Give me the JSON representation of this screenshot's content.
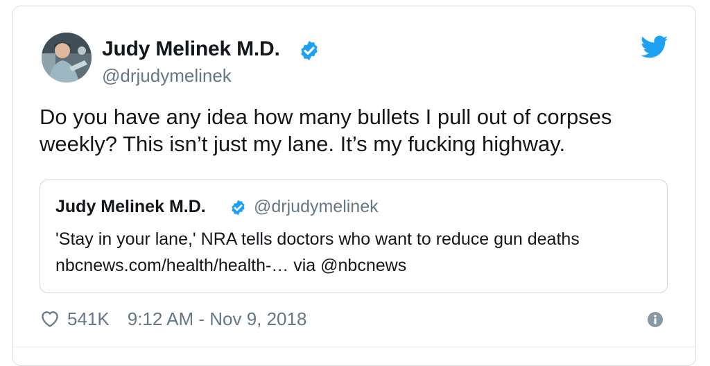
{
  "author": {
    "display_name": "Judy Melinek M.D.",
    "handle": "@drjudymelinek",
    "verified": true
  },
  "tweet": {
    "text_lines": [
      "Do you have any idea how many bullets I pull out of corpses",
      "weekly? This isn’t just my lane. It’s my fucking highway."
    ]
  },
  "quoted_tweet": {
    "display_name": "Judy Melinek M.D.",
    "handle": "@drjudymelinek",
    "text_lines": [
      "'Stay in your lane,' NRA tells doctors who want to reduce gun deaths",
      "nbcnews.com/health/health-… via @nbcnews"
    ]
  },
  "footer": {
    "likes": "541K",
    "timestamp": "9:12 AM - Nov 9, 2018"
  },
  "icons": {
    "verified": "verified-badge-icon",
    "brand": "twitter-bird-icon",
    "like": "heart-icon",
    "info": "info-icon"
  },
  "colors": {
    "brand_blue": "#1da1f2",
    "text": "#14171a",
    "secondary_text": "#657786",
    "border": "#ccd6dd"
  }
}
